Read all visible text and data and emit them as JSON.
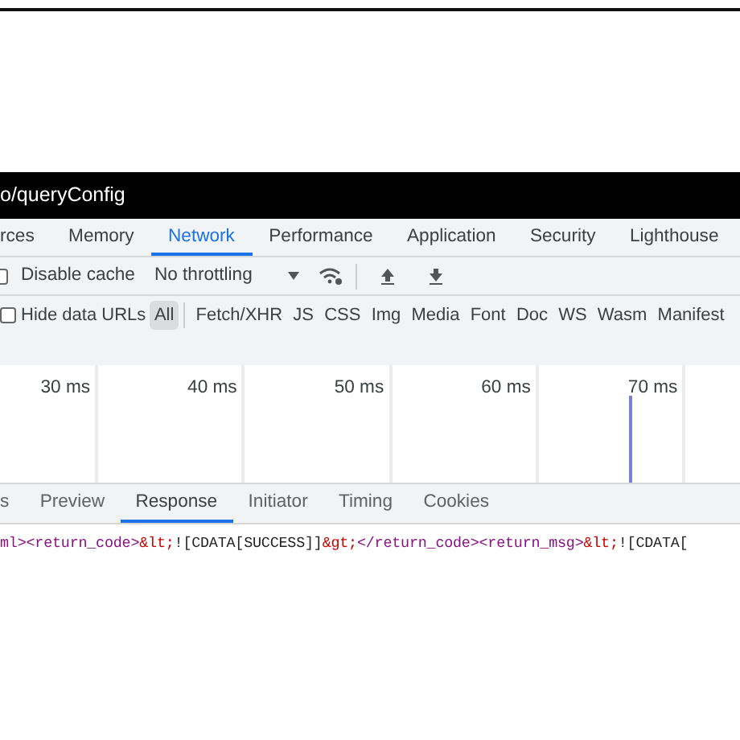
{
  "title_bar": {
    "title": "o/queryConfig"
  },
  "panel_tabs": [
    {
      "label": "rces",
      "selected": false
    },
    {
      "label": "Memory",
      "selected": false
    },
    {
      "label": "Network",
      "selected": true
    },
    {
      "label": "Performance",
      "selected": false
    },
    {
      "label": "Application",
      "selected": false
    },
    {
      "label": "Security",
      "selected": false
    },
    {
      "label": "Lighthouse",
      "selected": false
    }
  ],
  "toolbar": {
    "disable_cache": {
      "label": "Disable cache",
      "checked": false
    },
    "throttling": {
      "value": "No throttling"
    }
  },
  "filter_bar": {
    "hide_data_urls": {
      "label": "Hide data URLs",
      "checked": false
    },
    "filters": [
      {
        "label": "All",
        "selected": true
      },
      {
        "label": "Fetch/XHR",
        "selected": false
      },
      {
        "label": "JS",
        "selected": false
      },
      {
        "label": "CSS",
        "selected": false
      },
      {
        "label": "Img",
        "selected": false
      },
      {
        "label": "Media",
        "selected": false
      },
      {
        "label": "Font",
        "selected": false
      },
      {
        "label": "Doc",
        "selected": false
      },
      {
        "label": "WS",
        "selected": false
      },
      {
        "label": "Wasm",
        "selected": false
      },
      {
        "label": "Manifest",
        "selected": false
      }
    ]
  },
  "timeline": {
    "ticks": [
      "30 ms",
      "40 ms",
      "50 ms",
      "60 ms",
      "70 ms"
    ]
  },
  "detail_tabs": [
    {
      "label": "s",
      "selected": false
    },
    {
      "label": "Preview",
      "selected": false
    },
    {
      "label": "Response",
      "selected": true
    },
    {
      "label": "Initiator",
      "selected": false
    },
    {
      "label": "Timing",
      "selected": false
    },
    {
      "label": "Cookies",
      "selected": false
    }
  ],
  "response": [
    {
      "kind": "tag",
      "text": "ml>"
    },
    {
      "kind": "tag",
      "text": "<return_code>"
    },
    {
      "kind": "entity",
      "text": "&lt;"
    },
    {
      "kind": "text",
      "text": "![CDATA[SUCCESS]]"
    },
    {
      "kind": "entity",
      "text": "&gt;"
    },
    {
      "kind": "tag",
      "text": "</return_code>"
    },
    {
      "kind": "tag",
      "text": "<return_msg>"
    },
    {
      "kind": "entity",
      "text": "&lt;"
    },
    {
      "kind": "text",
      "text": "![CDATA["
    }
  ]
}
